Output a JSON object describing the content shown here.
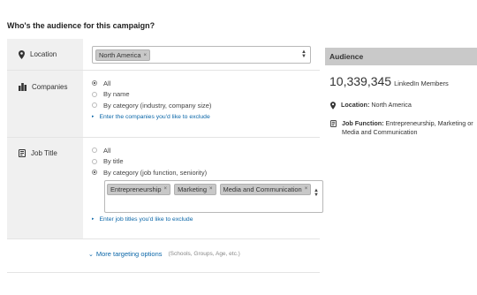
{
  "heading": "Who's the audience for this campaign?",
  "location": {
    "label": "Location",
    "icon": "map-pin-icon",
    "tags": [
      "North America"
    ]
  },
  "companies": {
    "label": "Companies",
    "icon": "buildings-icon",
    "options": [
      "All",
      "By name",
      "By category (industry, company size)"
    ],
    "selected": "All",
    "exclude_link": "Enter the companies you'd like to exclude"
  },
  "job_title": {
    "label": "Job Title",
    "icon": "id-card-icon",
    "options": [
      "All",
      "By title",
      "By category (job function, seniority)"
    ],
    "selected": "By category (job function, seniority)",
    "tags": [
      "Entrepreneurship",
      "Marketing",
      "Media and Communication"
    ],
    "exclude_link": "Enter job titles you'd like to exclude"
  },
  "more_targeting": {
    "link": "More targeting options",
    "hint": "(Schools, Groups, Age, etc.)"
  },
  "audience": {
    "title": "Audience",
    "count": "10,339,345",
    "count_unit": "LinkedIn Members",
    "location_label": "Location:",
    "location_value": "North America",
    "job_label": "Job Function:",
    "job_value": "Entrepreneurship, Marketing or Media and Communication"
  },
  "colors": {
    "link": "#0a66a8",
    "label_bg": "#f0f0f0",
    "audience_header_bg": "#c9c9c9",
    "pill_bg": "#c8c8c8"
  }
}
